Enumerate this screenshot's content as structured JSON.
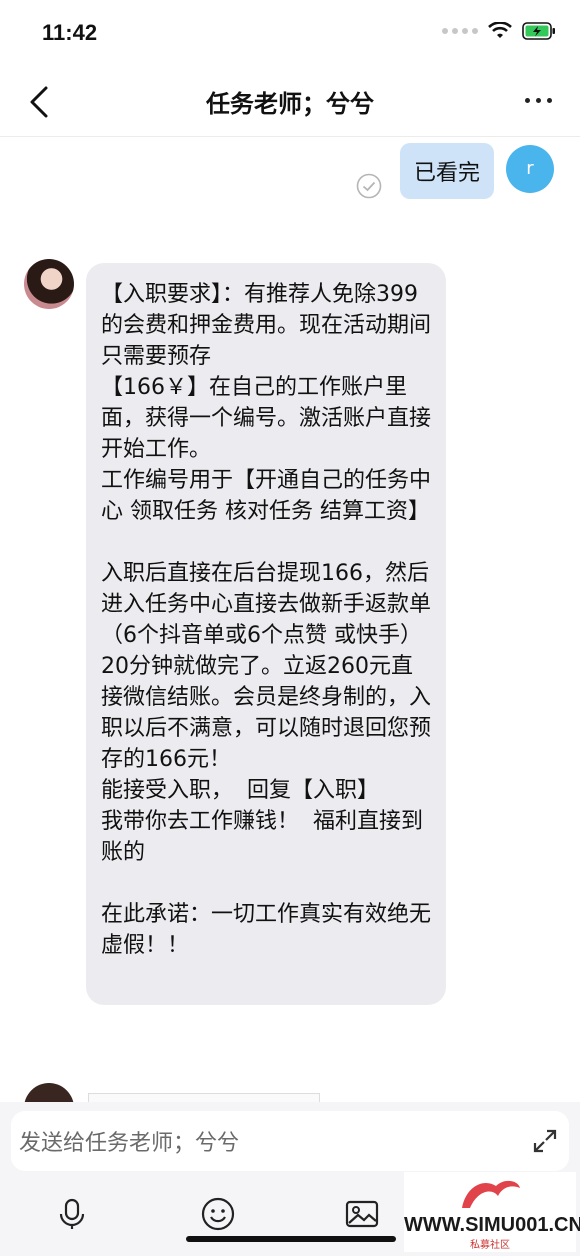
{
  "status": {
    "time": "11:42"
  },
  "nav": {
    "title": "任务老师；兮兮"
  },
  "messages": {
    "mine": {
      "text": "已看完",
      "avatar_letter": "r"
    },
    "theirs": {
      "text": "【入职要求】：有推荐人免除399的会费和押金费用。现在活动期间只需要预存\n【166￥】在自己的工作账户里面，获得一个编号。激活账户直接开始工作。\n工作编号用于【开通自己的任务中心 领取任务 核对任务 结算工资】\n\n入职后直接在后台提现166，然后进入任务中心直接去做新手返款单（6个抖音单或6个点赞 或快手）20分钟就做完了。立返260元直接微信结账。会员是终身制的，入职以后不满意，可以随时退回您预存的166元！\n能接受入职，  回复【入职】\n我带你去工作赚钱！  福利直接到账的\n\n在此承诺：一切工作真实有效绝无虚假！！"
    }
  },
  "input": {
    "placeholder": "发送给任务老师；兮兮"
  },
  "watermark": {
    "text": "WWW.SIMU001.CN",
    "sub": "私募社区"
  },
  "colors": {
    "my_bubble": "#cfe3f8",
    "their_bubble": "#ececf0",
    "avatar": "#4ab4ec"
  }
}
